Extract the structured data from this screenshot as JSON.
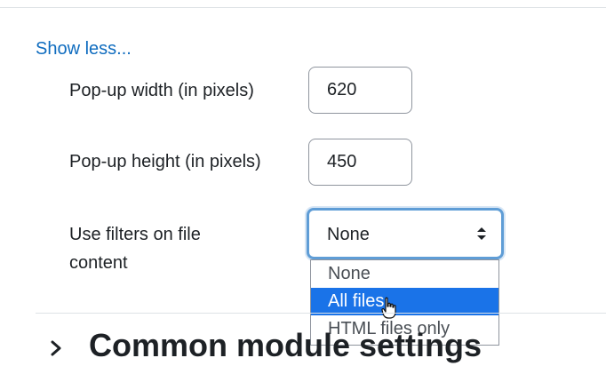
{
  "form": {
    "show_less_link": "Show less...",
    "popup_width": {
      "label": "Pop-up width (in pixels)",
      "value": "620"
    },
    "popup_height": {
      "label": "Pop-up height (in pixels)",
      "value": "450"
    },
    "filters": {
      "label_line1": "Use filters on file",
      "label_line2": "content",
      "selected_value": "None",
      "options": [
        "None",
        "All files",
        "HTML files only"
      ],
      "highlighted_option": "All files"
    }
  },
  "section": {
    "title": "Common module settings",
    "collapsed": true
  },
  "icons": {
    "select_arrows": "sort-arrows-icon",
    "section_toggle": "chevron-right-icon",
    "pointer": "hand-cursor-icon"
  },
  "colors": {
    "link": "#0f6cbf",
    "focus_ring": "#5f9dd6",
    "option_highlight": "#1a73e8",
    "text": "#1d2125"
  }
}
